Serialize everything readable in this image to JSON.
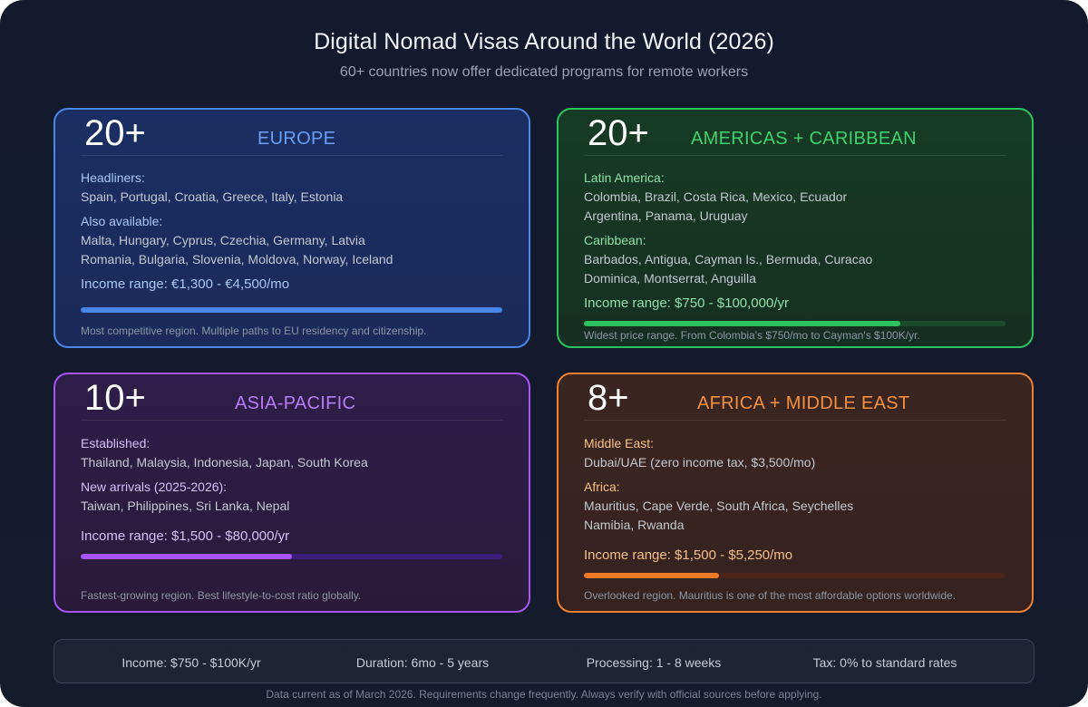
{
  "title": "Digital Nomad Visas Around the World (2026)",
  "subtitle": "60+ countries now offer dedicated programs for remote workers",
  "colors": {
    "europe": "#4a86e8",
    "americas": "#2ec25c",
    "asia": "#a855f7",
    "africa": "#f08030"
  },
  "regions": {
    "europe": {
      "count": "20+",
      "name": "EUROPE",
      "group1_label": "Headliners:",
      "group1_lines": [
        "Spain, Portugal, Croatia, Greece, Italy, Estonia"
      ],
      "group2_label": "Also available:",
      "group2_lines": [
        "Malta, Hungary, Cyprus, Czechia, Germany, Latvia",
        "Romania, Bulgaria, Slovenia, Moldova, Norway, Iceland"
      ],
      "income": "Income range: €1,300 - €4,500/mo",
      "bar_fraction": 1.0,
      "note": "Most competitive region. Multiple paths to EU residency and citizenship."
    },
    "americas": {
      "count": "20+",
      "name": "AMERICAS + CARIBBEAN",
      "group1_label": "Latin America:",
      "group1_lines": [
        "Colombia, Brazil, Costa Rica, Mexico, Ecuador",
        "Argentina, Panama, Uruguay"
      ],
      "group2_label": "Caribbean:",
      "group2_lines": [
        "Barbados, Antigua, Cayman Is., Bermuda, Curacao",
        "Dominica, Montserrat, Anguilla"
      ],
      "income": "Income range: $750 - $100,000/yr",
      "bar_fraction": 0.75,
      "note": "Widest price range. From Colombia's $750/mo to Cayman's $100K/yr."
    },
    "asia": {
      "count": "10+",
      "name": "ASIA-PACIFIC",
      "group1_label": "Established:",
      "group1_lines": [
        "Thailand, Malaysia, Indonesia, Japan, South Korea"
      ],
      "group2_label": "New arrivals (2025-2026):",
      "group2_lines": [
        "Taiwan, Philippines, Sri Lanka, Nepal"
      ],
      "income": "Income range: $1,500 - $80,000/yr",
      "bar_fraction": 0.5,
      "note": "Fastest-growing region. Best lifestyle-to-cost ratio globally."
    },
    "africa": {
      "count": "8+",
      "name": "AFRICA + MIDDLE EAST",
      "group1_label": "Middle East:",
      "group1_lines": [
        "Dubai/UAE (zero income tax, $3,500/mo)"
      ],
      "group2_label": "Africa:",
      "group2_lines": [
        "Mauritius, Cape Verde, South Africa, Seychelles",
        "Namibia, Rwanda"
      ],
      "income": "Income range: $1,500 - $5,250/mo",
      "bar_fraction": 0.32,
      "note": "Overlooked region. Mauritius is one of the most affordable options worldwide."
    }
  },
  "stats": {
    "income": "Income: $750 - $100K/yr",
    "duration": "Duration: 6mo - 5 years",
    "processing": "Processing: 1 - 8 weeks",
    "tax": "Tax: 0% to standard rates"
  },
  "footer": "Data current as of March 2026. Requirements change frequently. Always verify with official sources before applying."
}
